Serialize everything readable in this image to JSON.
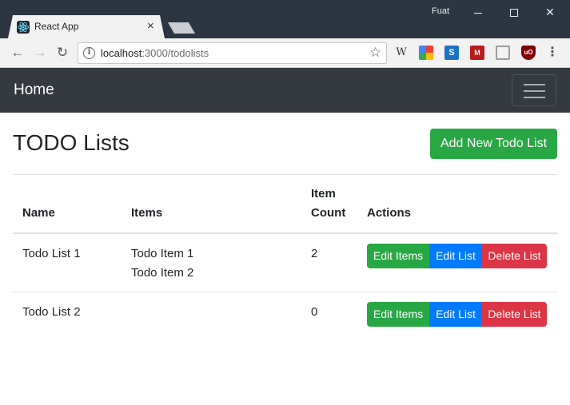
{
  "browser": {
    "tab_title": "React App",
    "tab_close": "×",
    "profile_name": "Fuat",
    "url_host": "localhost",
    "url_path": ":3000/todolists",
    "window_controls": {
      "close": "✕"
    },
    "extensions": [
      "W",
      "S",
      "M",
      "uO"
    ]
  },
  "navbar": {
    "brand": "Home"
  },
  "page": {
    "title": "TODO Lists",
    "add_button": "Add New Todo List"
  },
  "table": {
    "headers": {
      "name": "Name",
      "items": "Items",
      "count": "Item Count",
      "actions": "Actions"
    },
    "rows": [
      {
        "name": "Todo List 1",
        "items": [
          "Todo Item 1",
          "Todo Item 2"
        ],
        "count": "2"
      },
      {
        "name": "Todo List 2",
        "items": [],
        "count": "0"
      }
    ],
    "actions": {
      "edit_items": "Edit Items",
      "edit_list": "Edit List",
      "delete_list": "Delete List"
    }
  },
  "colors": {
    "success": "#28a745",
    "primary": "#007bff",
    "danger": "#dc3545",
    "navbar_dark": "#343a40",
    "chrome_frame": "#2b3642"
  }
}
